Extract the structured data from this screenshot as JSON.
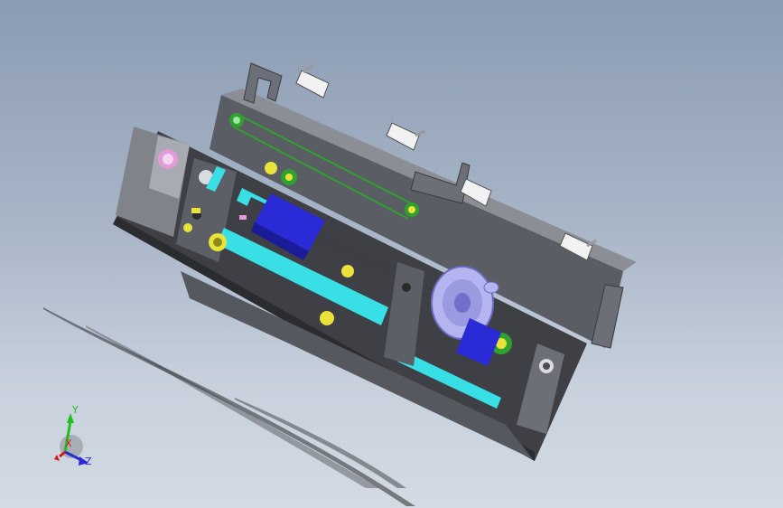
{
  "viewport": {
    "background_top": "#8a9bb2",
    "background_bottom": "#d3dae3"
  },
  "triad": {
    "x_label": "X",
    "y_label": "Y",
    "z_label": "Z",
    "x_color": "#d01a1a",
    "y_color": "#1fbf1f",
    "z_color": "#2a2ad8"
  },
  "model": {
    "colors": {
      "housing": "#4a4c52",
      "housing_light": "#8a8d94",
      "plate": "#6c6f77",
      "shaft": "#38e0e6",
      "bearing": "#e8e23a",
      "motor": "#2a2ad6",
      "handwheel": "#b4b4f0",
      "belt": "#2fa12f",
      "rod": "#3e3f44",
      "sensor": "#f2f2f2",
      "accent_pink": "#e29ad8"
    }
  }
}
